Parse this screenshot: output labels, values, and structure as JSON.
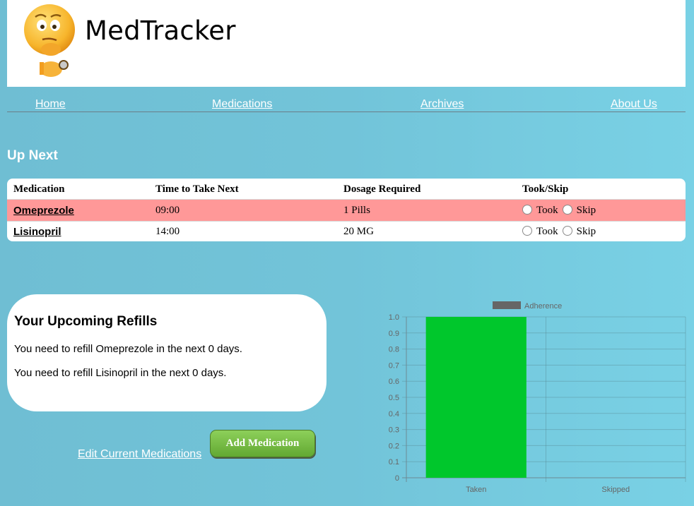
{
  "app": {
    "title": "MedTracker"
  },
  "nav": {
    "items": [
      "Home",
      "Medications",
      "Archives",
      "About Us"
    ]
  },
  "up_next": {
    "title": "Up Next",
    "columns": [
      "Medication",
      "Time to Take Next",
      "Dosage Required",
      "Took/Skip"
    ],
    "rows": [
      {
        "medication": "Omeprezole",
        "time": "09:00",
        "dosage": "1 Pills",
        "highlight": "#ff9898"
      },
      {
        "medication": "Lisinopril",
        "time": "14:00",
        "dosage": "20 MG",
        "highlight": "#ffffff"
      }
    ],
    "took_label": "Took",
    "skip_label": "Skip"
  },
  "refills": {
    "title": "Your Upcoming Refills",
    "lines": [
      "You need to refill Omeprezole in the next 0 days.",
      "You need to refill Lisinopril in the next 0 days."
    ]
  },
  "actions": {
    "edit_label": "Edit Current Medications",
    "add_label": "Add Medication"
  },
  "chart_data": {
    "type": "bar",
    "categories": [
      "Taken",
      "Skipped"
    ],
    "series": [
      {
        "name": "Adherence",
        "values": [
          1.0,
          0
        ],
        "color": "#00c72c"
      }
    ],
    "ylim": [
      0,
      1.0
    ],
    "yticks": [
      "0",
      "0.1",
      "0.2",
      "0.3",
      "0.4",
      "0.5",
      "0.6",
      "0.7",
      "0.8",
      "0.9",
      "1.0"
    ],
    "legend_placement": "top",
    "grid": true
  }
}
